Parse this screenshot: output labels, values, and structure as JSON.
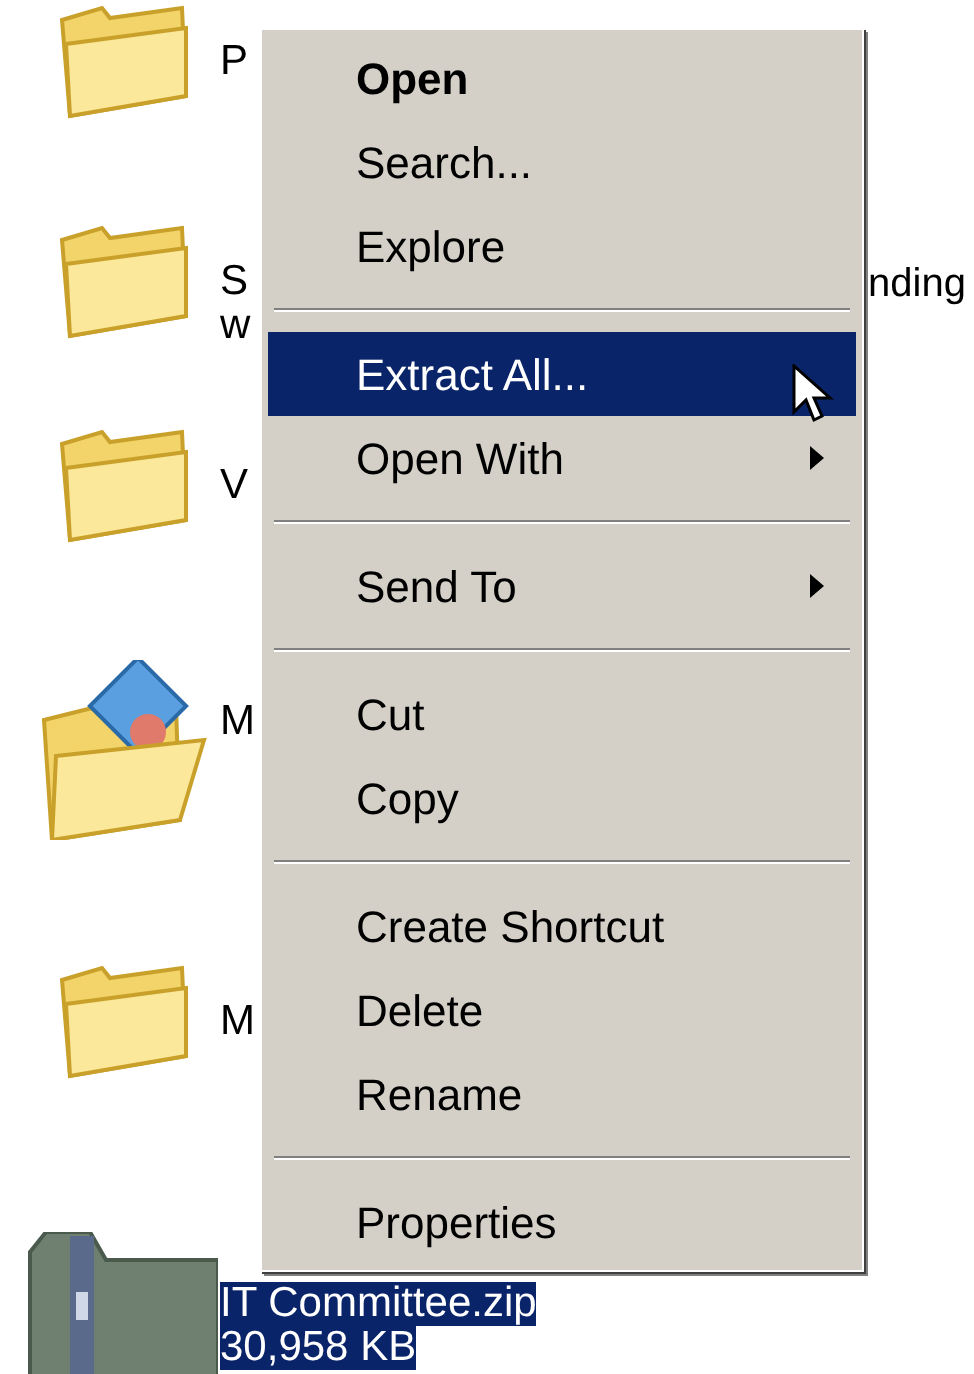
{
  "files": [
    {
      "kind": "folder",
      "lines": [
        "P"
      ]
    },
    {
      "kind": "folder",
      "lines": [
        "S",
        "w"
      ],
      "trailing": "nding"
    },
    {
      "kind": "folder",
      "lines": [
        "V"
      ]
    },
    {
      "kind": "contacts",
      "lines": [
        "M"
      ]
    },
    {
      "kind": "folder",
      "lines": [
        "M"
      ]
    },
    {
      "kind": "zip",
      "lines": [
        "IT Committee.zip",
        "30,958 KB"
      ],
      "selected": true
    }
  ],
  "context_menu": {
    "items": [
      {
        "kind": "item",
        "label": "Open",
        "default": true,
        "selected": false,
        "submenu": false
      },
      {
        "kind": "item",
        "label": "Search...",
        "default": false,
        "selected": false,
        "submenu": false
      },
      {
        "kind": "item",
        "label": "Explore",
        "default": false,
        "selected": false,
        "submenu": false
      },
      {
        "kind": "separator"
      },
      {
        "kind": "item",
        "label": "Extract All...",
        "default": false,
        "selected": true,
        "submenu": false
      },
      {
        "kind": "item",
        "label": "Open With",
        "default": false,
        "selected": false,
        "submenu": true
      },
      {
        "kind": "separator"
      },
      {
        "kind": "item",
        "label": "Send To",
        "default": false,
        "selected": false,
        "submenu": true
      },
      {
        "kind": "separator"
      },
      {
        "kind": "item",
        "label": "Cut",
        "default": false,
        "selected": false,
        "submenu": false
      },
      {
        "kind": "item",
        "label": "Copy",
        "default": false,
        "selected": false,
        "submenu": false
      },
      {
        "kind": "separator"
      },
      {
        "kind": "item",
        "label": "Create Shortcut",
        "default": false,
        "selected": false,
        "submenu": false
      },
      {
        "kind": "item",
        "label": "Delete",
        "default": false,
        "selected": false,
        "submenu": false
      },
      {
        "kind": "item",
        "label": "Rename",
        "default": false,
        "selected": false,
        "submenu": false
      },
      {
        "kind": "separator"
      },
      {
        "kind": "item",
        "label": "Properties",
        "default": false,
        "selected": false,
        "submenu": false
      }
    ]
  }
}
